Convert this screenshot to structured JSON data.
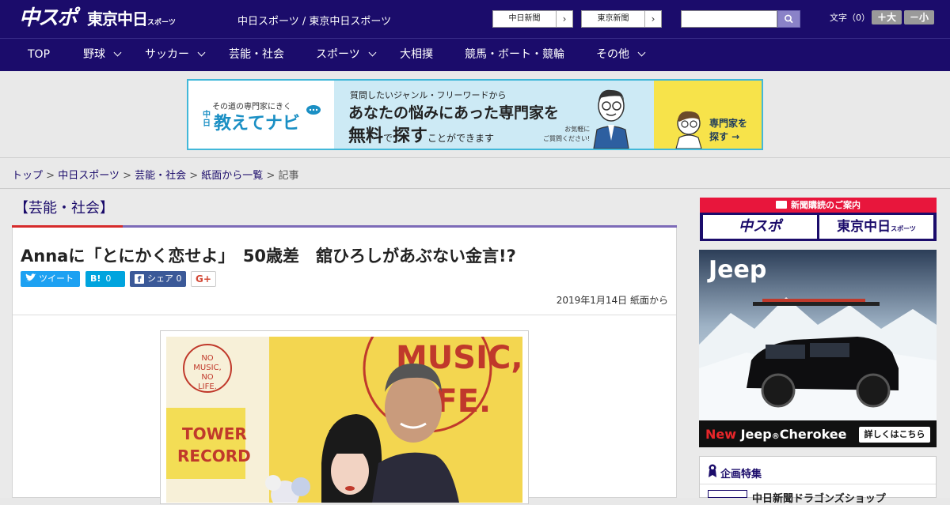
{
  "header": {
    "logo_chuspo": "中スポ",
    "logo_tokyo": "東京中日",
    "logo_tokyo_sub": "スポーツ",
    "tagline": "中日スポーツ / 東京中日スポーツ",
    "paper_buttons": [
      "中日新聞",
      "東京新聞"
    ],
    "font_size_label": "文字（0）",
    "font_larger": "＋大",
    "font_smaller": "－小"
  },
  "nav": [
    {
      "label": "TOP",
      "dropdown": false
    },
    {
      "label": "野球",
      "dropdown": true
    },
    {
      "label": "サッカー",
      "dropdown": true
    },
    {
      "label": "芸能・社会",
      "dropdown": false
    },
    {
      "label": "スポーツ",
      "dropdown": true
    },
    {
      "label": "大相撲",
      "dropdown": false
    },
    {
      "label": "競馬・ボート・競輪",
      "dropdown": false
    },
    {
      "label": "その他",
      "dropdown": true
    }
  ],
  "banner": {
    "left_small": "その道の専門家にきく",
    "left_chu": "中日",
    "left_main": "教えてナビ",
    "line1": "質問したいジャンル・フリーワードから",
    "line2": "あなたの悩みにあった専門家を",
    "line3_a": "無料",
    "line3_b": "で",
    "line3_c": "探す",
    "line3_d": "ことができます",
    "note1": "お気軽に",
    "note2": "ご質問ください!",
    "cta1": "専門家を",
    "cta2": "探す →"
  },
  "breadcrumb": {
    "items": [
      "トップ",
      "中日スポーツ",
      "芸能・社会",
      "紙面から一覧"
    ],
    "current": "記事",
    "sep": " > "
  },
  "article": {
    "category": "【芸能・社会】",
    "headline": "Annaに「とにかく恋せよ」　50歳差　舘ひろしがあぶない金言!?",
    "share": {
      "tweet": "ツイート",
      "hatena": "B!",
      "hatena_count": "0",
      "facebook": "シェア",
      "facebook_count": "0",
      "gplus": "G+"
    },
    "date": "2019年1月14日 紙面から"
  },
  "sidebar": {
    "subscribe_title": "新聞購読のご案内",
    "subscribe_logo1": "中スポ",
    "subscribe_logo2": "東京中日",
    "subscribe_logo2_sub": "スポーツ",
    "jeep_logo": "Jeep",
    "jeep_new": "New ",
    "jeep_model": "Jeep",
    "jeep_reg": "®",
    "jeep_name": "Cherokee",
    "jeep_cta": "詳しくはこちら",
    "special_title": "企画特集",
    "special_item": "中日新聞ドラゴンズショップ"
  },
  "colors": {
    "brand_navy": "#1b0c6b",
    "accent_red": "#d62b2b",
    "accent_purple": "#7d6bb8",
    "twitter": "#1da1f2",
    "hatena": "#00a4de",
    "facebook": "#3b5998"
  }
}
